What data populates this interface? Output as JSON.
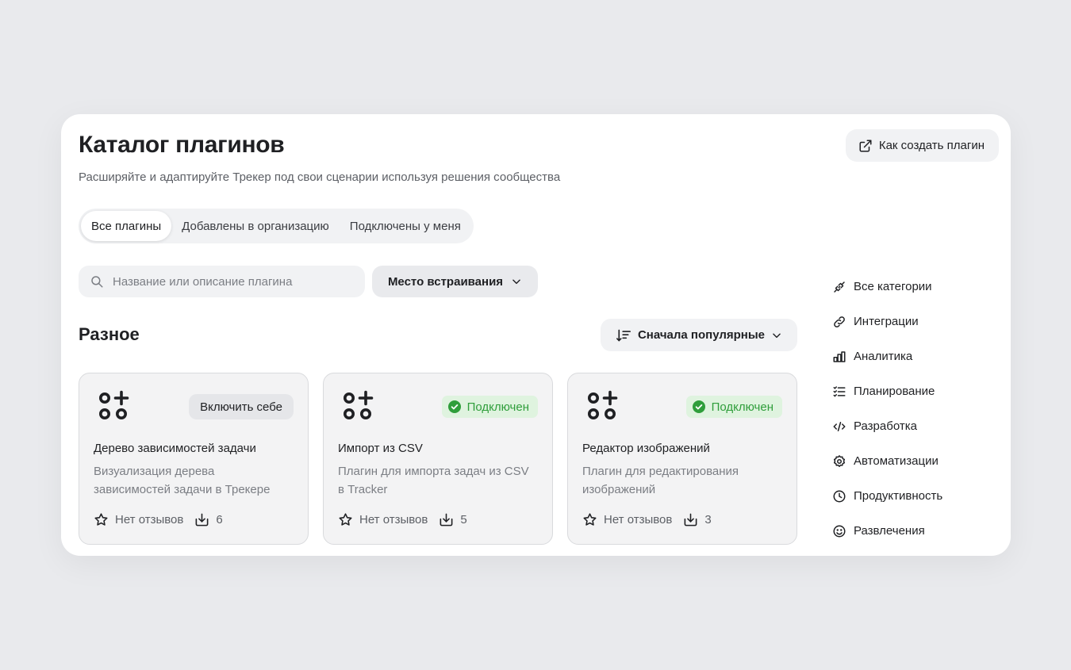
{
  "header": {
    "title": "Каталог плагинов",
    "subtitle": "Расширяйте и адаптируйте Трекер под свои сценарии используя решения сообщества",
    "help_button": "Как создать плагин"
  },
  "tabs": [
    {
      "label": "Все плагины",
      "active": true
    },
    {
      "label": "Добавлены в организацию",
      "active": false
    },
    {
      "label": "Подключены у меня",
      "active": false
    }
  ],
  "search": {
    "placeholder": "Название или описание плагина",
    "value": ""
  },
  "placement_filter": {
    "label": "Место встраивания"
  },
  "section": {
    "title": "Разное",
    "sort_label": "Сначала популярные"
  },
  "cards": [
    {
      "name": "Дерево зависимостей задачи",
      "description": "Визуализация дерева зависимостей задачи в Трекере",
      "action": "Включить себе",
      "status": "",
      "reviews": "Нет отзывов",
      "installs": "6"
    },
    {
      "name": "Импорт из CSV",
      "description": "Плагин для импорта задач из CSV в Tracker",
      "action": "",
      "status": "Подключен",
      "reviews": "Нет отзывов",
      "installs": "5"
    },
    {
      "name": "Редактор изображений",
      "description": "Плагин для редактирования изображений",
      "action": "",
      "status": "Подключен",
      "reviews": "Нет отзывов",
      "installs": "3"
    }
  ],
  "categories": [
    {
      "label": "Все категории",
      "icon": "puzzle-icon"
    },
    {
      "label": "Интеграции",
      "icon": "link-icon"
    },
    {
      "label": "Аналитика",
      "icon": "bar-chart-icon"
    },
    {
      "label": "Планирование",
      "icon": "checklist-icon"
    },
    {
      "label": "Разработка",
      "icon": "code-icon"
    },
    {
      "label": "Автоматизации",
      "icon": "gear-icon"
    },
    {
      "label": "Продуктивность",
      "icon": "clock-icon"
    },
    {
      "label": "Развлечения",
      "icon": "smile-icon"
    }
  ],
  "colors": {
    "background": "#e9eaed",
    "panel": "#ffffff",
    "text": "#1f2023",
    "muted": "#7b7e84",
    "success": "#2f9e3b",
    "success_bg": "#dff3df"
  }
}
